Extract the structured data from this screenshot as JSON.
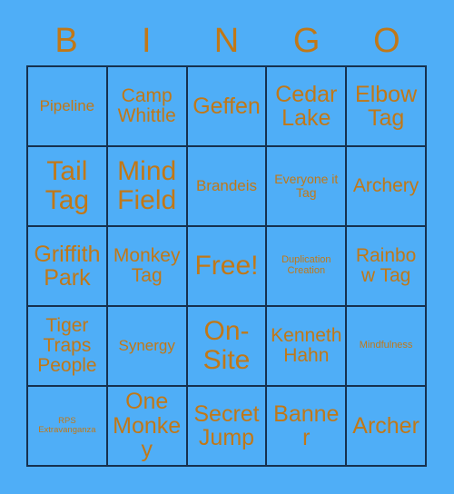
{
  "card": {
    "title": "BINGO",
    "background_color": "#4FAEF7",
    "text_color": "#C17817",
    "border_color": "#16314F",
    "header": {
      "letters": [
        "B",
        "I",
        "N",
        "G",
        "O"
      ]
    },
    "grid": {
      "columns": 5,
      "rows": 5,
      "free_space": "Free!",
      "cells": [
        [
          {
            "label": "Pipeline",
            "size": "md"
          },
          {
            "label": "Camp Whittle",
            "size": "lg"
          },
          {
            "label": "Geffen",
            "size": "xl"
          },
          {
            "label": "Cedar Lake",
            "size": "xl"
          },
          {
            "label": "Elbow Tag",
            "size": "xl"
          }
        ],
        [
          {
            "label": "Tail Tag",
            "size": "xxl"
          },
          {
            "label": "Mind Field",
            "size": "xxl"
          },
          {
            "label": "Brandeis",
            "size": "md"
          },
          {
            "label": "Everyone it Tag",
            "size": "sm"
          },
          {
            "label": "Archery",
            "size": "lg"
          }
        ],
        [
          {
            "label": "Griffith Park",
            "size": "xl"
          },
          {
            "label": "Monkey Tag",
            "size": "lg"
          },
          {
            "label": "Free!",
            "size": "xxl",
            "free": true
          },
          {
            "label": "Duplication Creation",
            "size": "xs"
          },
          {
            "label": "Rainbow Tag",
            "size": "lg"
          }
        ],
        [
          {
            "label": "Tiger Traps People",
            "size": "lg"
          },
          {
            "label": "Synergy",
            "size": "md"
          },
          {
            "label": "On-Site",
            "size": "xxl"
          },
          {
            "label": "Kenneth Hahn",
            "size": "lg"
          },
          {
            "label": "Mindfulness",
            "size": "xs"
          }
        ],
        [
          {
            "label": "RPS Extravanganza",
            "size": "xxs"
          },
          {
            "label": "One Monkey",
            "size": "xl"
          },
          {
            "label": "Secret Jump",
            "size": "xl"
          },
          {
            "label": "Banner",
            "size": "xl"
          },
          {
            "label": "Archer",
            "size": "xl"
          }
        ]
      ]
    }
  }
}
